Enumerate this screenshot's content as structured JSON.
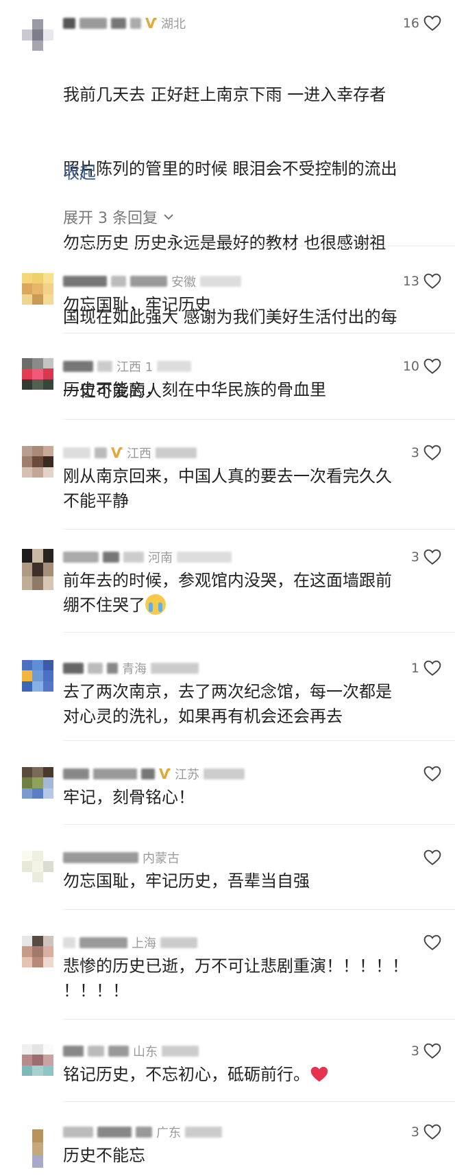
{
  "top_comment": {
    "location": "湖北",
    "likes": "16",
    "lines": [
      "我前几天去 正好赶上南京下雨 一进入幸存者",
      "照片陈列的管里的时候 眼泪会不受控制的流出",
      "勿忘历史 历史永远是最好的教材 也很感谢祖",
      "国现在如此强大 感谢为我们美好生活付出的每",
      "一位可爱的人"
    ],
    "collapse_label": "收起",
    "expand_label": "展开 3 条回复"
  },
  "comments": [
    {
      "location": "安徽",
      "likes": "13",
      "text": "勿忘国耻，牢记历史"
    },
    {
      "location": "江西 1",
      "likes": "10",
      "text": "历史不能忘，刻在中华民族的骨血里"
    },
    {
      "location": "江西",
      "likes": "3",
      "text": "刚从南京回来，中国人真的要去一次看完久久\n不能平静"
    },
    {
      "location": "河南",
      "likes": "3",
      "text": "前年去的时候，参观馆内没哭，在这面墙跟前\n绷不住哭了"
    },
    {
      "location": "青海",
      "likes": "1",
      "text": "去了两次南京，去了两次纪念馆，每一次都是\n对心灵的洗礼，如果再有机会还会再去"
    },
    {
      "location": "江苏",
      "likes": "",
      "text": "牢记，刻骨铭心！"
    },
    {
      "location": "内蒙古",
      "likes": "",
      "text": "勿忘国耻，牢记历史，吾辈当自强"
    },
    {
      "location": "上海",
      "likes": "",
      "text": "悲惨的历史已逝，万不可让悲剧重演！！！！！\n！！！！"
    },
    {
      "location": "山东",
      "likes": "3",
      "text": "铭记历史，不忘初心，砥砺前行。"
    },
    {
      "location": "广东",
      "likes": "3",
      "text": "历史不能忘"
    }
  ],
  "icons": {
    "like": "heart-outline-icon",
    "expand": "chevron-down-icon",
    "badge": "gold-badge-icon"
  },
  "colors": {
    "link": "#3d5a8c",
    "badge": "#e2a83a",
    "meta": "#9a9a9a"
  }
}
